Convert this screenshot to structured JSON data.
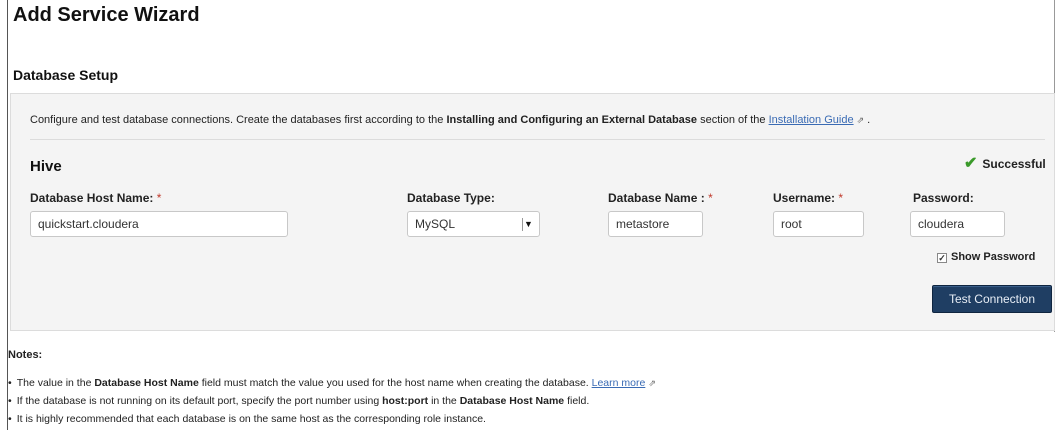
{
  "title": "Add Service Wizard",
  "section_title": "Database Setup",
  "intro": {
    "text1": "Configure and test database connections. Create the databases first according to the ",
    "bold": "Installing and Configuring an External Database",
    "text2": " section of the ",
    "link": "Installation Guide",
    "text3": " ."
  },
  "service": {
    "name": "Hive",
    "status": "Successful",
    "status_color": "#3a9a2a"
  },
  "fields": {
    "host": {
      "label": "Database Host Name:",
      "required": "*",
      "value": "quickstart.cloudera"
    },
    "type": {
      "label": "Database Type:",
      "value": "MySQL"
    },
    "name": {
      "label": "Database Name :",
      "required": "*",
      "value": "metastore"
    },
    "user": {
      "label": "Username:",
      "required": "*",
      "value": "root"
    },
    "pass": {
      "label": "Password:",
      "value": "cloudera"
    }
  },
  "show_password": {
    "label": "Show Password",
    "checked": true
  },
  "test_button": "Test Connection",
  "notes": {
    "title": "Notes:",
    "n1": {
      "a": "The value in the ",
      "b1": "Database Host Name",
      "c": " field must match the value you used for the host name when creating the database. ",
      "link": "Learn more"
    },
    "n2": {
      "a": "If the database is not running on its default port, specify the port number using ",
      "b1": "host:port",
      "c": " in the ",
      "b2": "Database Host Name",
      "d": " field."
    },
    "n3": {
      "a": "It is highly recommended that each database is on the same host as the corresponding role instance."
    }
  },
  "colors": {
    "accent_button": "#1f3e63",
    "link": "#3a6bb4",
    "required": "#c0392b"
  }
}
